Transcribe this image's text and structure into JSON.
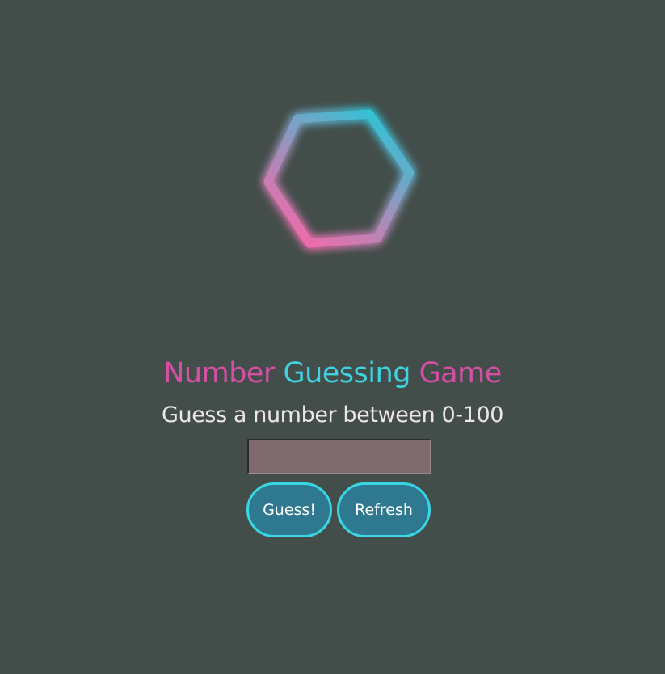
{
  "title": {
    "word1": "Number",
    "word2": "Guessing",
    "word3": "Game"
  },
  "subtitle": "Guess a number between 0-100",
  "input": {
    "value": "",
    "placeholder": ""
  },
  "buttons": {
    "guess_label": "Guess!",
    "refresh_label": "Refresh"
  },
  "colors": {
    "background": "#434e4a",
    "accent_pink": "#d64fa6",
    "accent_cyan": "#3dd3e0",
    "button_fill": "#2e7990",
    "input_fill": "#7f6b6e"
  },
  "icons": {
    "logo": "glowing-hexagon-icon"
  }
}
